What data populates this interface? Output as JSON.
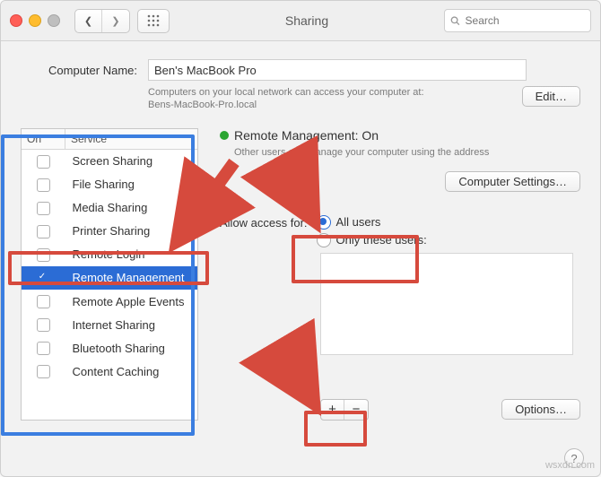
{
  "window": {
    "title": "Sharing",
    "search_placeholder": "Search"
  },
  "computer_name": {
    "label": "Computer Name:",
    "value": "Ben's MacBook Pro",
    "help1": "Computers on your local network can access your computer at:",
    "help2": "Bens-MacBook-Pro.local",
    "edit_label": "Edit…"
  },
  "services_header": {
    "on": "On",
    "service": "Service"
  },
  "services": [
    {
      "on": false,
      "label": "Screen Sharing"
    },
    {
      "on": false,
      "label": "File Sharing"
    },
    {
      "on": false,
      "label": "Media Sharing"
    },
    {
      "on": false,
      "label": "Printer Sharing"
    },
    {
      "on": false,
      "label": "Remote Login"
    },
    {
      "on": true,
      "label": "Remote Management"
    },
    {
      "on": false,
      "label": "Remote Apple Events"
    },
    {
      "on": false,
      "label": "Internet Sharing"
    },
    {
      "on": false,
      "label": "Bluetooth Sharing"
    },
    {
      "on": false,
      "label": "Content Caching"
    }
  ],
  "selected_index": 5,
  "status": {
    "title": "Remote Management: On",
    "help": "Other users can manage your computer using the address"
  },
  "computer_settings_label": "Computer Settings…",
  "access": {
    "label": "Allow access for:",
    "all": "All users",
    "only": "Only these users:",
    "selected": "all"
  },
  "add_label": "+",
  "remove_label": "−",
  "options_label": "Options…",
  "help_icon": "?",
  "watermark": "wsxdn.com"
}
